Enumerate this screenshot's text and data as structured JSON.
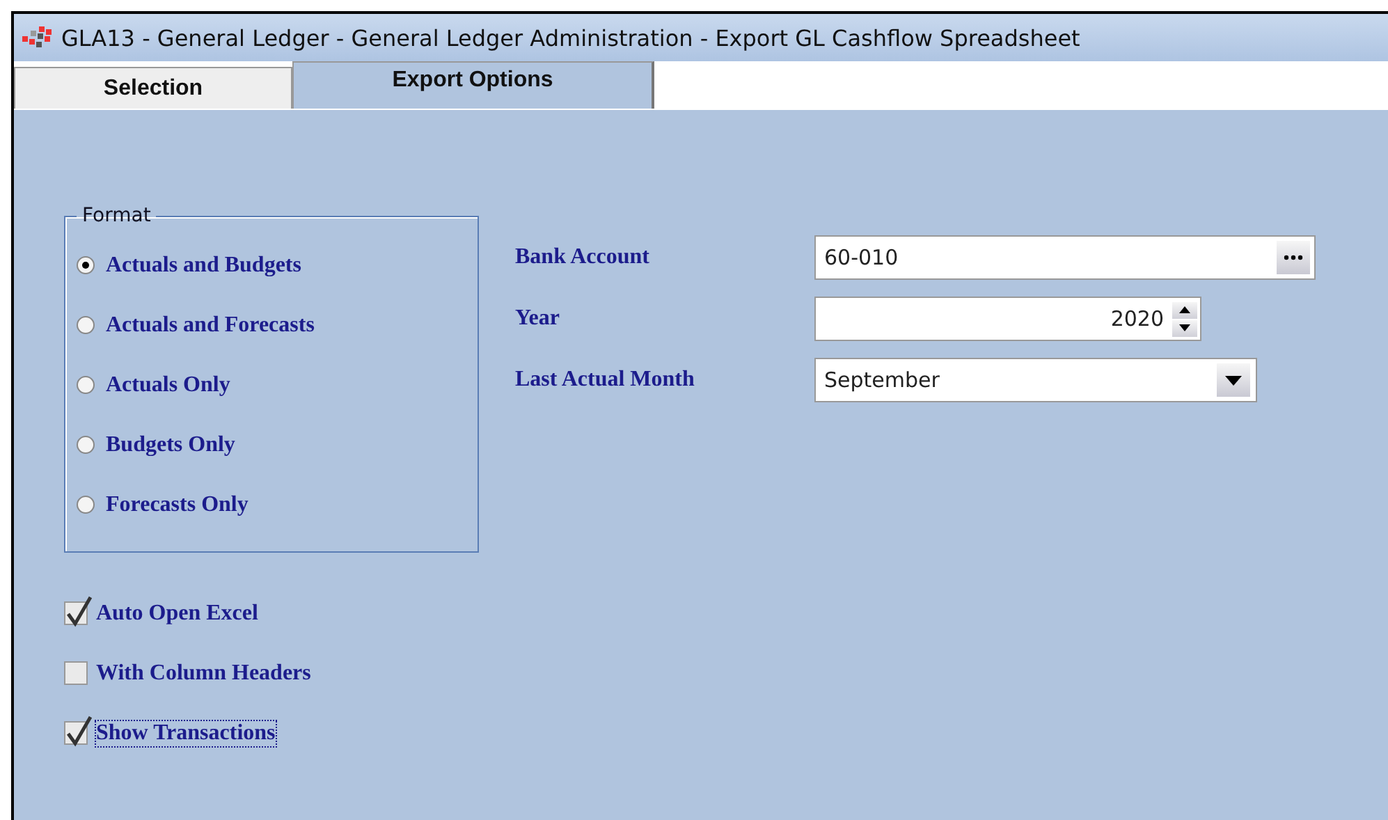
{
  "window": {
    "title": "GLA13 - General Ledger - General Ledger Administration - Export GL Cashflow Spreadsheet"
  },
  "tabs": [
    {
      "label": "Selection",
      "selected": false
    },
    {
      "label": "Export Options",
      "selected": true
    }
  ],
  "format": {
    "legend": "Format",
    "options": [
      {
        "label": "Actuals and Budgets",
        "selected": true
      },
      {
        "label": "Actuals and Forecasts",
        "selected": false
      },
      {
        "label": "Actuals Only",
        "selected": false
      },
      {
        "label": "Budgets Only",
        "selected": false
      },
      {
        "label": "Forecasts Only",
        "selected": false
      }
    ]
  },
  "fields": [
    {
      "kind": "browse",
      "label": "Bank Account",
      "value": "60-010"
    },
    {
      "kind": "spin",
      "label": "Year",
      "value": "2020"
    },
    {
      "kind": "dropdown",
      "label": "Last Actual Month",
      "value": "September"
    }
  ],
  "checkboxes": [
    {
      "label": "Auto Open Excel",
      "checked": true,
      "focused": false
    },
    {
      "label": "With Column Headers",
      "checked": false,
      "focused": false
    },
    {
      "label": "Show Transactions",
      "checked": true,
      "focused": true
    }
  ]
}
